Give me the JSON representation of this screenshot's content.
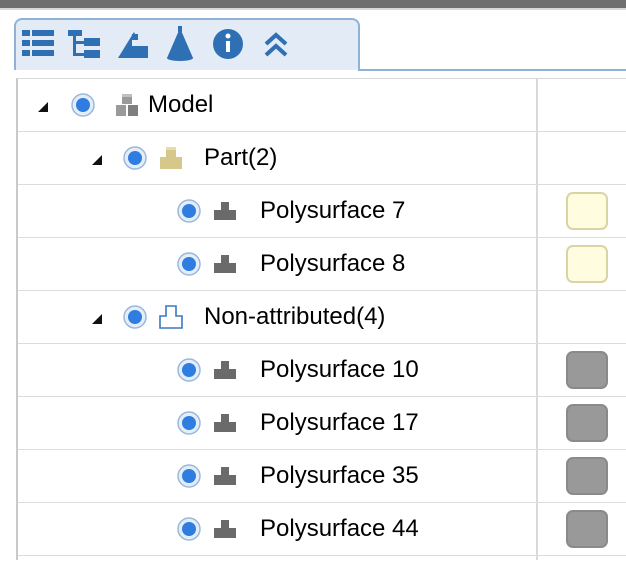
{
  "toolbar": {
    "buttons": [
      {
        "name": "list-view-icon"
      },
      {
        "name": "tree-view-icon"
      },
      {
        "name": "surface-icon"
      },
      {
        "name": "cone-icon"
      },
      {
        "name": "info-icon"
      },
      {
        "name": "collapse-up-icon"
      }
    ]
  },
  "tree": {
    "model": {
      "label": "Model",
      "icon": "model-blocks-icon"
    },
    "part": {
      "label": "Part(2)",
      "icon": "part-icon"
    },
    "part_items": [
      {
        "label": "Polysurface 7",
        "color": "#fffce0"
      },
      {
        "label": "Polysurface 8",
        "color": "#fffce0"
      }
    ],
    "non_attributed": {
      "label": "Non-attributed(4)",
      "icon": "non-attributed-outline-icon"
    },
    "non_attributed_items": [
      {
        "label": "Polysurface 10",
        "color": "#999999"
      },
      {
        "label": "Polysurface 17",
        "color": "#999999"
      },
      {
        "label": "Polysurface 35",
        "color": "#999999"
      },
      {
        "label": "Polysurface 44",
        "color": "#999999"
      }
    ]
  },
  "colors": {
    "accent": "#4a8fd4",
    "toolbar_bg": "#e3ecf6",
    "icon_blue": "#3a78c2"
  }
}
